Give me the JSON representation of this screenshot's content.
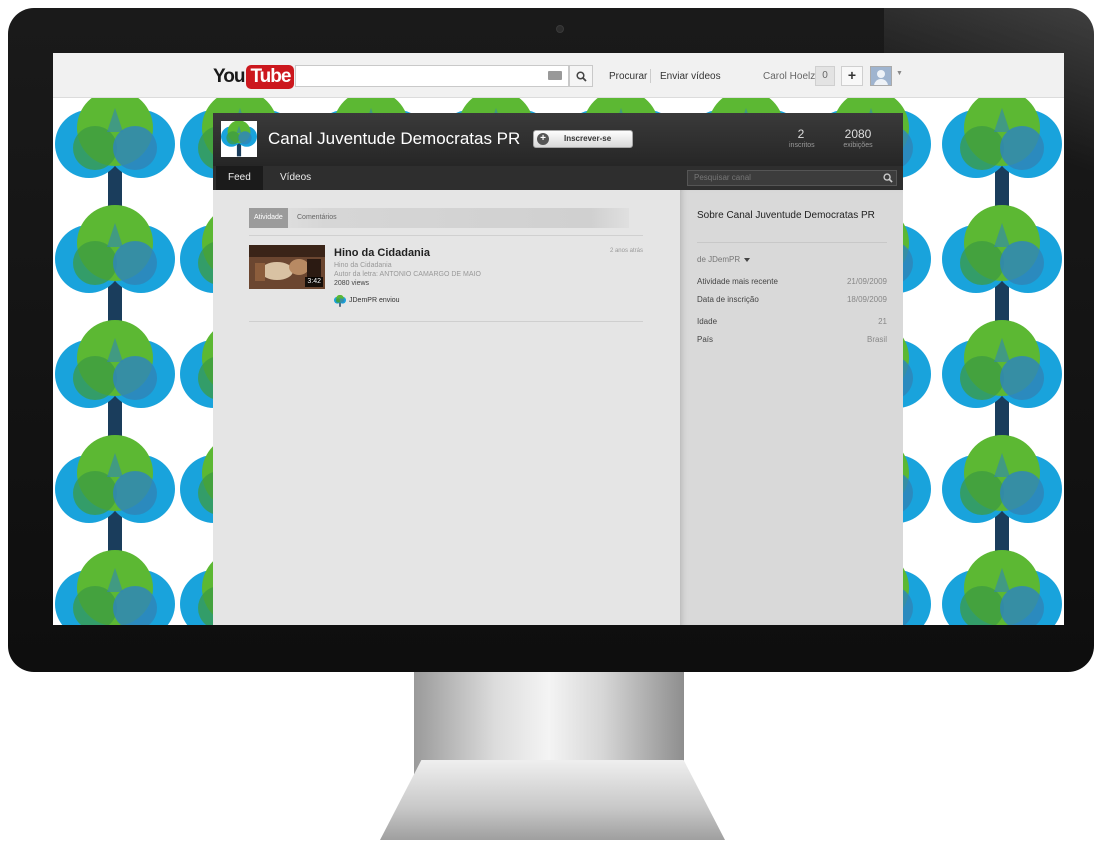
{
  "youtube": {
    "logo_you": "You",
    "logo_tube": "Tube",
    "search_placeholder": "",
    "search_label": "Procurar",
    "upload_label": "Enviar vídeos",
    "user_name": "Carol Hoelz",
    "notification_count": "0",
    "add_label": "+"
  },
  "channel": {
    "name": "Canal Juventude Democratas PR",
    "subscribe_label": "Inscrever-se",
    "stats": [
      {
        "value": "2",
        "label": "inscritos"
      },
      {
        "value": "2080",
        "label": "exibições"
      }
    ],
    "tabs": [
      "Feed",
      "Vídeos"
    ],
    "search_placeholder": "Pesquisar canal"
  },
  "feed": {
    "tabs": [
      "Atividade",
      "Comentários"
    ],
    "items": [
      {
        "title": "Hino da Cidadania",
        "description_line1": "Hino da Cidadania",
        "description_line2": "Autor da letra: ANTONIO CAMARGO DE MAIO",
        "views": "2080 views",
        "age": "2 anos atrás",
        "duration": "3:42",
        "uploader": "JDemPR enviou"
      }
    ]
  },
  "sidebar": {
    "about_title": "Sobre Canal Juventude Democratas PR",
    "owner": "de JDemPR",
    "rows": [
      {
        "label": "Atividade mais recente",
        "value": "21/09/2009"
      },
      {
        "label": "Data de inscrição",
        "value": "18/09/2009"
      },
      {
        "label": "Idade",
        "value": "21"
      },
      {
        "label": "País",
        "value": "Brasil"
      }
    ]
  },
  "colors": {
    "tree_blue": "#1aa0d8",
    "tree_green": "#5cb833",
    "tree_dark": "#1c6c8c",
    "trunk": "#1a3d5c",
    "youtube_red": "#cc181e"
  }
}
